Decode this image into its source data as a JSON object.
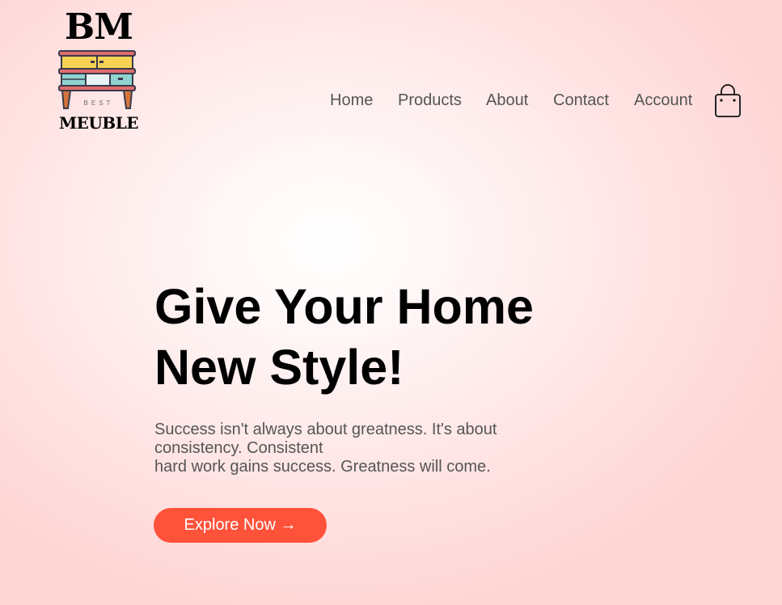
{
  "brand": {
    "logo_top": "BM",
    "logo_small": "BEST",
    "logo_bottom": "MEUBLE"
  },
  "nav": {
    "items": [
      {
        "label": "Home"
      },
      {
        "label": "Products"
      },
      {
        "label": "About"
      },
      {
        "label": "Contact"
      },
      {
        "label": "Account"
      }
    ],
    "cart_icon": "shopping-bag-icon"
  },
  "hero": {
    "title_line1": "Give Your Home",
    "title_line2": "New Style!",
    "text_line1": "Success isn't always about greatness. It's about",
    "text_line2": "consistency. Consistent",
    "text_line3": "hard work gains success. Greatness will come.",
    "button_label": "Explore Now →"
  },
  "colors": {
    "accent": "#ff523b",
    "text_muted": "#555555",
    "background_edge": "#ffd6d6"
  }
}
